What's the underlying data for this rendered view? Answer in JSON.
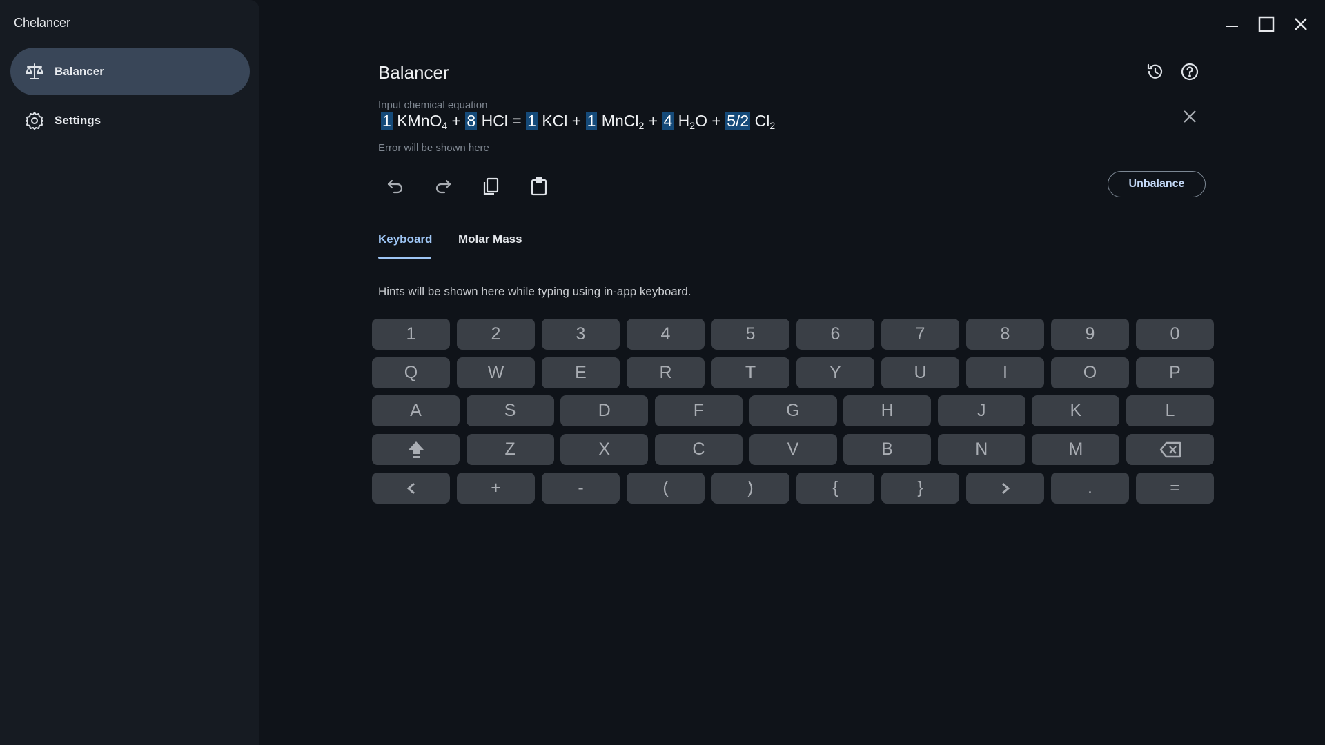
{
  "app": {
    "title": "Chelancer"
  },
  "sidebar": {
    "items": [
      {
        "label": "Balancer",
        "icon": "balance-scale-icon",
        "active": true
      },
      {
        "label": "Settings",
        "icon": "gear-icon",
        "active": false
      }
    ]
  },
  "main": {
    "title": "Balancer",
    "input_label": "Input chemical equation",
    "error_text": "Error will be shown here",
    "equation": [
      {
        "coef": "1",
        "formula": "KMnO",
        "sub": "4"
      },
      {
        "sep": "+"
      },
      {
        "coef": "8",
        "formula": "HCl"
      },
      {
        "sep": "="
      },
      {
        "coef": "1",
        "formula": "KCl"
      },
      {
        "sep": "+"
      },
      {
        "coef": "1",
        "formula": "MnCl",
        "sub": "2"
      },
      {
        "sep": "+"
      },
      {
        "coef": "4",
        "formula": "H",
        "sub": "2",
        "formula_tail": "O"
      },
      {
        "sep": "+"
      },
      {
        "coef": "5/2",
        "formula": "Cl",
        "sub": "2"
      }
    ],
    "unbalance_label": "Unbalance",
    "tabs": [
      {
        "label": "Keyboard",
        "active": true
      },
      {
        "label": "Molar Mass",
        "active": false
      }
    ],
    "hint": "Hints will be shown here while typing using in-app keyboard."
  },
  "keyboard": {
    "rows": [
      [
        "1",
        "2",
        "3",
        "4",
        "5",
        "6",
        "7",
        "8",
        "9",
        "0"
      ],
      [
        "Q",
        "W",
        "E",
        "R",
        "T",
        "Y",
        "U",
        "I",
        "O",
        "P"
      ],
      [
        "A",
        "S",
        "D",
        "F",
        "G",
        "H",
        "J",
        "K",
        "L"
      ],
      [
        "shift-icon",
        "Z",
        "X",
        "C",
        "V",
        "B",
        "N",
        "M",
        "backspace-icon"
      ],
      [
        "chevron-left-icon",
        "+",
        "-",
        "(",
        ")",
        "{",
        "}",
        "chevron-right-icon",
        ".",
        "="
      ]
    ]
  },
  "colors": {
    "accent": "#9ec5f4",
    "coef_highlight": "#154a79",
    "key_bg": "#3a3f46",
    "sidebar_active": "#394658"
  }
}
